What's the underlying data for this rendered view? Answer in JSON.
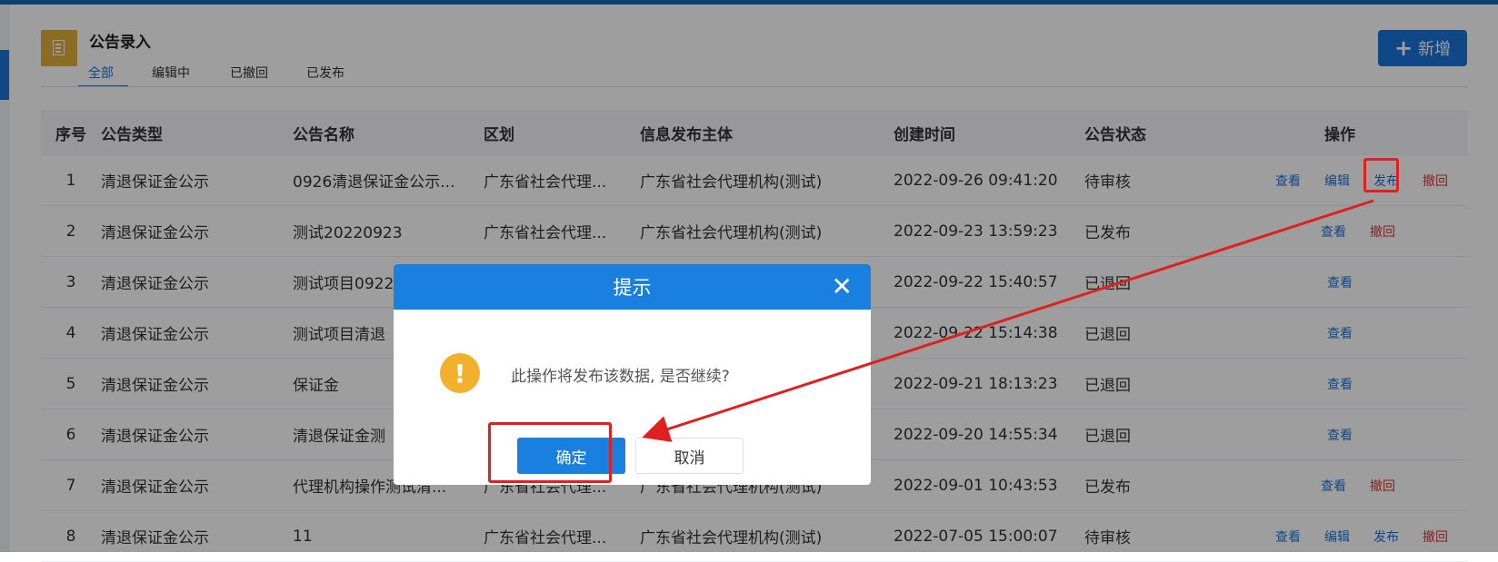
{
  "header": {
    "title": "公告录入",
    "add_button_label": "新增"
  },
  "tabs": [
    {
      "label": "全部",
      "active": true
    },
    {
      "label": "编辑中",
      "active": false
    },
    {
      "label": "已撤回",
      "active": false
    },
    {
      "label": "已发布",
      "active": false
    }
  ],
  "table": {
    "columns": [
      "序号",
      "公告类型",
      "公告名称",
      "区划",
      "信息发布主体",
      "创建时间",
      "公告状态",
      "操作"
    ],
    "rows": [
      {
        "no": "1",
        "type": "清退保证金公示",
        "name": "0926清退保证金公示...",
        "region": "广东省社会代理...",
        "publisher": "广东省社会代理机构(测试)",
        "created": "2022-09-26 09:41:20",
        "status": "待审核",
        "actions": [
          "查看",
          "编辑",
          "发布",
          "撤回"
        ]
      },
      {
        "no": "2",
        "type": "清退保证金公示",
        "name": "测试20220923",
        "region": "广东省社会代理...",
        "publisher": "广东省社会代理机构(测试)",
        "created": "2022-09-23 13:59:23",
        "status": "已发布",
        "actions": [
          "查看",
          "撤回"
        ]
      },
      {
        "no": "3",
        "type": "清退保证金公示",
        "name": "测试项目0922",
        "region": "",
        "publisher": "",
        "created": "2022-09-22 15:40:57",
        "status": "已退回",
        "actions": [
          "查看"
        ]
      },
      {
        "no": "4",
        "type": "清退保证金公示",
        "name": "测试项目清退",
        "region": "",
        "publisher": "",
        "created": "2022-09-22 15:14:38",
        "status": "已退回",
        "actions": [
          "查看"
        ]
      },
      {
        "no": "5",
        "type": "清退保证金公示",
        "name": "保证金",
        "region": "",
        "publisher": "",
        "created": "2022-09-21 18:13:23",
        "status": "已退回",
        "actions": [
          "查看"
        ]
      },
      {
        "no": "6",
        "type": "清退保证金公示",
        "name": "清退保证金测",
        "region": "",
        "publisher": "",
        "created": "2022-09-20 14:55:34",
        "status": "已退回",
        "actions": [
          "查看"
        ]
      },
      {
        "no": "7",
        "type": "清退保证金公示",
        "name": "代理机构操作测试清...",
        "region": "广东省社会代理...",
        "publisher": "广东省社会代理机构(测试)",
        "created": "2022-09-01 10:43:53",
        "status": "已发布",
        "actions": [
          "查看",
          "撤回"
        ]
      },
      {
        "no": "8",
        "type": "清退保证金公示",
        "name": "11",
        "region": "广东省社会代理...",
        "publisher": "广东省社会代理机构(测试)",
        "created": "2022-07-05 15:00:07",
        "status": "待审核",
        "actions": [
          "查看",
          "编辑",
          "发布",
          "撤回"
        ]
      }
    ]
  },
  "dialog": {
    "title": "提示",
    "close_glyph": "✕",
    "icon_glyph": "!",
    "message": "此操作将发布该数据, 是否继续?",
    "confirm_label": "确定",
    "cancel_label": "取消"
  },
  "colors": {
    "primary": "#1a73d9",
    "danger": "#d33333",
    "warning": "#f1b12c",
    "highlight": "#e02020"
  }
}
